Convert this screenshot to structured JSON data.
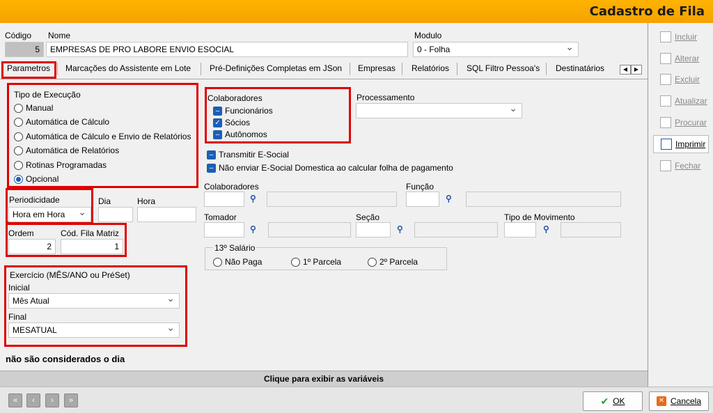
{
  "window": {
    "title": "Cadastro de Fila"
  },
  "header": {
    "codigo_label": "Código",
    "codigo_value": "5",
    "nome_label": "Nome",
    "nome_value": "EMPRESAS DE PRO LABORE ENVIO ESOCIAL",
    "modulo_label": "Modulo",
    "modulo_value": "0 - Folha"
  },
  "tabs": [
    "Parametros",
    "Marcações do Assistente em Lote",
    "Pré-Definições Completas em JSon",
    "Empresas",
    "Relatórios",
    "SQL Filtro Pessoa's",
    "Destinatários"
  ],
  "tipo_execucao": {
    "title": "Tipo de Execução",
    "options": [
      "Manual",
      "Automática de Cálculo",
      "Automática de Cálculo e Envio de Relatórios",
      "Automática de Relatórios",
      "Rotinas Programadas",
      "Opcional"
    ],
    "selected": "Opcional"
  },
  "periodicidade": {
    "label": "Periodicidade",
    "value": "Hora em Hora",
    "dia_label": "Dia",
    "dia_value": "",
    "hora_label": "Hora",
    "hora_value": ""
  },
  "ordem": {
    "label": "Ordem",
    "value": "2",
    "fila_matriz_label": "Cód. Fila Matriz",
    "fila_matriz_value": "1"
  },
  "exercicio": {
    "title": "Exercício (MÊS/ANO ou PréSet)",
    "inicial_label": "Inicial",
    "inicial_value": "Mês Atual",
    "final_label": "Final",
    "final_value": "MESATUAL"
  },
  "note": "não são considerados o dia",
  "colaboradores_box": {
    "title": "Colaboradores",
    "items": [
      "Funcionários",
      "Sócios",
      "Autônomos"
    ]
  },
  "processamento": {
    "label": "Processamento",
    "value": ""
  },
  "transmitir": "Transmitir E-Social",
  "nao_enviar": "Não enviar E-Social Domestica ao calcular folha de pagamento",
  "filters": {
    "colaboradores": "Colaboradores",
    "funcao": "Função",
    "tomador": "Tomador",
    "secao": "Seção",
    "tipo_movimento": "Tipo de Movimento"
  },
  "decimo_terceiro": {
    "title": "13º Salário",
    "options": [
      "Não Paga",
      "1º Parcela",
      "2º Parcela"
    ]
  },
  "bottom_bar": "Clique para exibir as variáveis",
  "side_buttons": [
    "Incluir",
    "Alterar",
    "Excluir",
    "Atualizar",
    "Procurar",
    "Imprimir",
    "Fechar"
  ],
  "footer": {
    "ok": "OK",
    "cancel": "Cancela"
  },
  "colors": {
    "accent": "#f5a200",
    "highlight": "#e00000",
    "selection": "#1a5fb4"
  }
}
